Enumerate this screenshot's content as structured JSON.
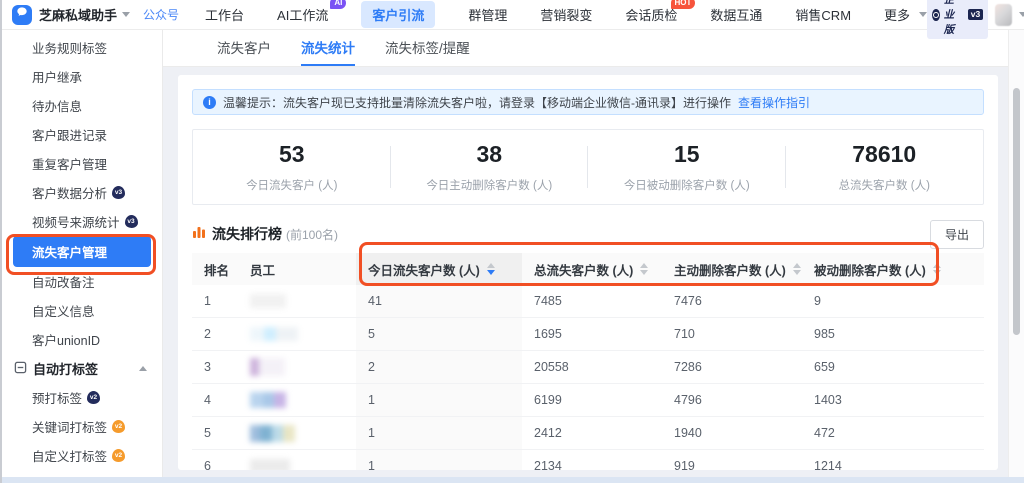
{
  "colors": {
    "accent_blue": "#2e7cf6",
    "annotation_orange": "#f14f24",
    "nav_active_bg": "#d9e8ff",
    "alert_bg": "#e9f4ff",
    "badge_ai_purple": "#7a52f4",
    "badge_hot_red": "#f7543c",
    "vbadge_dark": "#232c5c",
    "vbadge_orange": "#f59b2c",
    "rank_icon_orange": "#f2711c"
  },
  "topbar": {
    "app_title": "芝麻私域助手",
    "app_badge": "公众号",
    "nav": [
      {
        "label": "工作台"
      },
      {
        "label": "AI工作流",
        "badge": "AI"
      },
      {
        "label": "客户引流",
        "active": true
      },
      {
        "label": "群管理"
      },
      {
        "label": "营销裂变"
      },
      {
        "label": "会话质检",
        "badge": "HOT"
      },
      {
        "label": "数据互通"
      },
      {
        "label": "销售CRM"
      },
      {
        "label": "更多"
      }
    ],
    "account": {
      "plan": "企业版",
      "version": "v3"
    }
  },
  "sidebar": {
    "items": [
      {
        "label": "业务规则标签"
      },
      {
        "label": "用户继承"
      },
      {
        "label": "待办信息"
      },
      {
        "label": "客户跟进记录"
      },
      {
        "label": "重复客户管理"
      },
      {
        "label": "客户数据分析",
        "badge": "v3"
      },
      {
        "label": "视频号来源统计",
        "badge": "v3"
      },
      {
        "label": "流失客户管理",
        "active": true
      },
      {
        "label": "自动改备注"
      },
      {
        "label": "自定义信息"
      },
      {
        "label": "客户unionID"
      }
    ],
    "section": {
      "label": "自动打标签"
    },
    "section_items": [
      {
        "label": "预打标签",
        "badge": "v2"
      },
      {
        "label": "关键词打标签",
        "badge": "v2"
      },
      {
        "label": "自定义打标签",
        "badge": "v2"
      }
    ]
  },
  "tabs": {
    "items": [
      {
        "label": "流失客户"
      },
      {
        "label": "流失统计",
        "active": true
      },
      {
        "label": "流失标签/提醒"
      }
    ]
  },
  "alert": {
    "text": "温馨提示：流失客户现已支持批量清除流失客户啦，请登录【移动端企业微信-通讯录】进行操作",
    "link": "查看操作指引"
  },
  "stats": [
    {
      "value": "53",
      "label": "今日流失客户 (人)"
    },
    {
      "value": "38",
      "label": "今日主动删除客户数 (人)"
    },
    {
      "value": "15",
      "label": "今日被动删除客户数 (人)"
    },
    {
      "value": "78610",
      "label": "总流失客户数 (人)"
    }
  ],
  "ranking": {
    "title": "流失排行榜",
    "subtitle": "(前100名)",
    "export_label": "导出",
    "columns": [
      "排名",
      "员工",
      "今日流失客户数 (人)",
      "总流失客户数 (人)",
      "主动删除客户数 (人)",
      "被动删除客户数 (人)"
    ],
    "sorted_column": "今日流失客户数 (人)",
    "sort_direction": "desc",
    "rows": [
      {
        "rank": "1",
        "today": "41",
        "total": "7485",
        "active_del": "7476",
        "passive_del": "9"
      },
      {
        "rank": "2",
        "today": "5",
        "total": "1695",
        "active_del": "710",
        "passive_del": "985"
      },
      {
        "rank": "3",
        "today": "2",
        "total": "20558",
        "active_del": "7286",
        "passive_del": "659"
      },
      {
        "rank": "4",
        "today": "1",
        "total": "6199",
        "active_del": "4796",
        "passive_del": "1403"
      },
      {
        "rank": "5",
        "today": "1",
        "total": "2412",
        "active_del": "1940",
        "passive_del": "472"
      },
      {
        "rank": "6",
        "today": "1",
        "total": "2134",
        "active_del": "919",
        "passive_del": "1214"
      }
    ]
  }
}
